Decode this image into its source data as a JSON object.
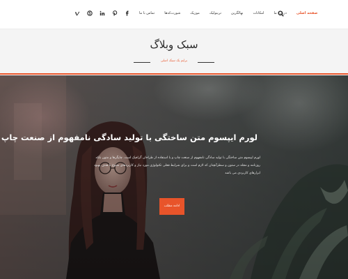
{
  "header": {
    "social_icons": [
      "vimeo-icon",
      "skype-icon",
      "linkedin-icon",
      "pinterest-icon",
      "facebook-icon"
    ],
    "nav_items": [
      {
        "label": "تماس با ما",
        "active": false
      },
      {
        "label": "شورت‌کدها",
        "active": false
      },
      {
        "label": "موزیک",
        "active": false
      },
      {
        "label": "ترینولیک",
        "active": false
      },
      {
        "label": "نهالگرین",
        "active": false
      },
      {
        "label": "امکانات",
        "active": false
      },
      {
        "label": "درباره ما",
        "active": false
      },
      {
        "label": "صفحه اصلی",
        "active": true
      }
    ],
    "search_icon": "search-icon"
  },
  "blog": {
    "title": "سبک وبلاگ",
    "subtitle": "برایم یک سبک اصلی"
  },
  "hero": {
    "title": "لورم ایپسوم متن ساختگی با تولید سادگی نامفهوم از صنعت چاپ",
    "body": "لورم ایپسوم متن ساختگی با تولید سادگی نامفهوم از صنعت چاپ و با استفاده از طراحان گرافیک است. چاپگرها و متون بلکه روزنامه و مجله در ستون و سطرآنچنان که لازم است و برای شرایط فعلی تکنولوژی مورد نیاز و کاربردهای متنوع با هدف بهبود ابزارهای کاربردی می باشد",
    "button_label": "ادامه مطلب"
  },
  "colors": {
    "accent": "#e8542a",
    "band": "#f4f4f4",
    "hero_overlay": "#4b4d4c"
  }
}
